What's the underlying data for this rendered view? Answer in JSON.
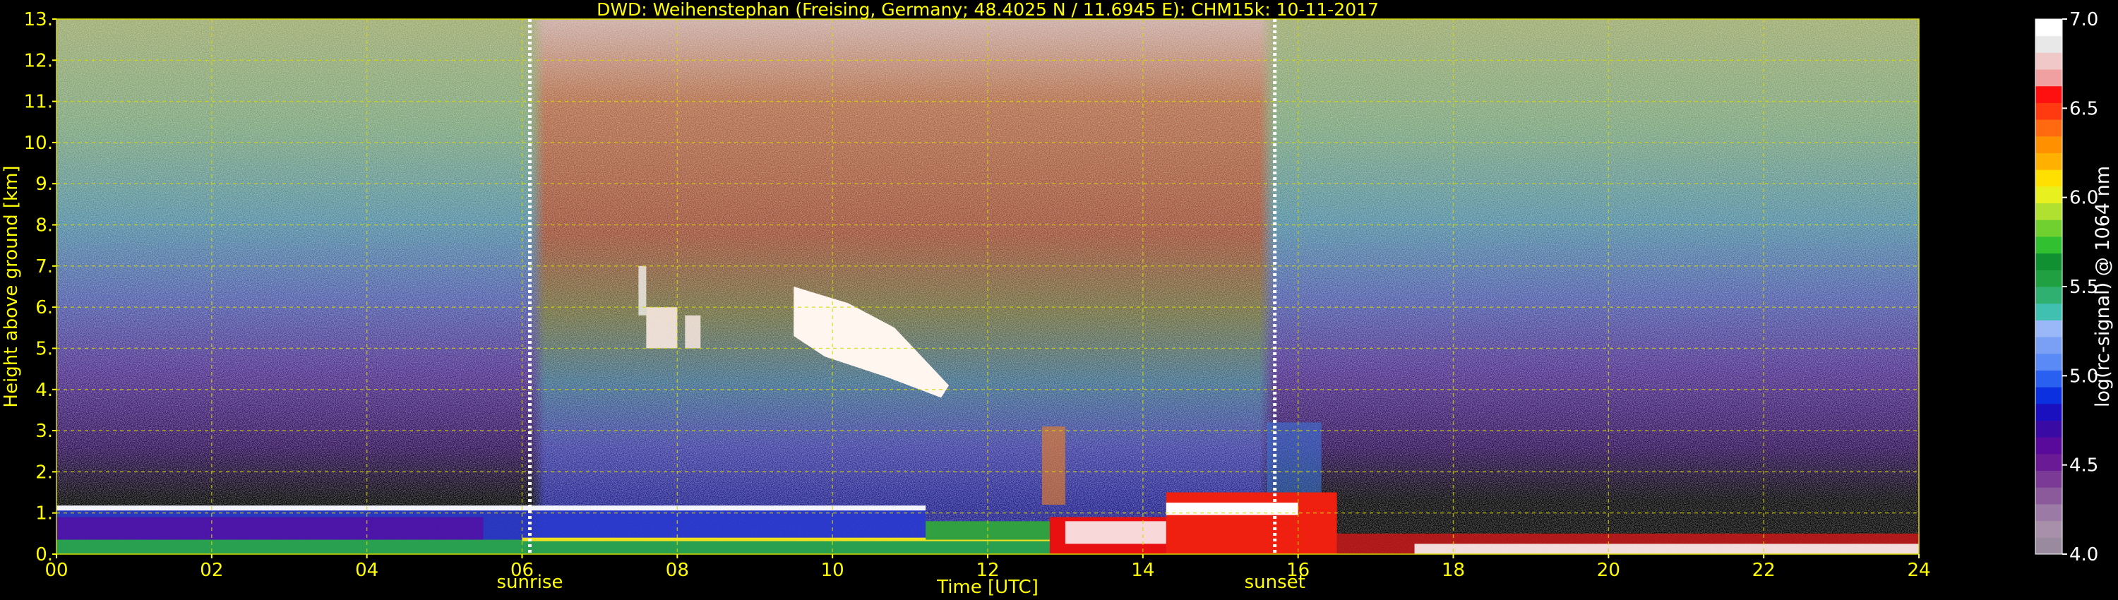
{
  "chart_data": {
    "type": "heatmap",
    "title": "DWD: Weihenstephan (Freising, Germany; 48.4025 N / 11.6945 E):    CHM15k: 10-11-2017",
    "xlabel": "Time [UTC]",
    "ylabel": "Height above ground [km]",
    "xlim": [
      0,
      24
    ],
    "ylim": [
      0,
      13
    ],
    "x_ticks": [
      "00",
      "02",
      "04",
      "06",
      "08",
      "10",
      "12",
      "14",
      "16",
      "18",
      "20",
      "22",
      "24"
    ],
    "y_ticks": [
      "0.",
      "1.",
      "2.",
      "3.",
      "4.",
      "5.",
      "6.",
      "7.",
      "8.",
      "9.",
      "10.",
      "11.",
      "12.",
      "13."
    ],
    "grid": true,
    "colorbar": {
      "label": "log(rc-signal) @ 1064 nm",
      "range": [
        4.0,
        7.0
      ],
      "ticks": [
        "4.0",
        "4.5",
        "5.0",
        "5.5",
        "6.0",
        "6.5",
        "7.0"
      ],
      "colors": [
        "#9a8aa0",
        "#a890aa",
        "#9b7aa5",
        "#8a5a9a",
        "#7a3a95",
        "#6a1a95",
        "#5a0a9a",
        "#3a0aa5",
        "#1a10c0",
        "#0a30e0",
        "#2a60f0",
        "#5a8af5",
        "#7aa0f5",
        "#9ab8f8",
        "#40c0b0",
        "#30b070",
        "#20a040",
        "#109030",
        "#30c030",
        "#70d030",
        "#b0e030",
        "#e8f020",
        "#ffe000",
        "#ffb000",
        "#ff9000",
        "#ff6a10",
        "#ff3a10",
        "#ff1010",
        "#f0a0a0",
        "#f0c8c8",
        "#e8e8e8",
        "#ffffff"
      ]
    },
    "annotations": [
      {
        "text": "sunrise",
        "x": 6.1
      },
      {
        "text": "sunset",
        "x": 15.7
      }
    ],
    "features": {
      "boundary_layer_top_km": 1.1,
      "cloud_layer": {
        "x_start": 9.5,
        "x_end": 11.5,
        "y_bottom": 3.8,
        "y_top": 6.5
      },
      "daytime_convective_layer": {
        "x_start": 12.8,
        "x_end": 16.5,
        "y_top": 1.5
      }
    }
  }
}
